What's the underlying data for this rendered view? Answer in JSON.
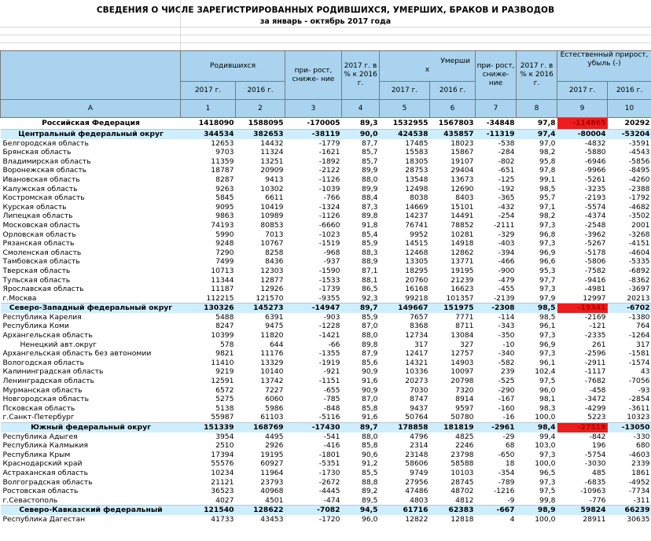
{
  "title": "СВЕДЕНИЯ О ЧИСЛЕ ЗАРЕГИСТРИРОВАННЫХ  РОДИВШИХСЯ, УМЕРШИХ, БРАКОВ И РАЗВОДОВ",
  "subtitle": "за январь - октябрь 2017 года",
  "header": {
    "births": "Родившихся",
    "births_growth": "при- рост, сниже- ние",
    "births_pct": "2017 г. в % к 2016 г.",
    "deaths_a": "Умерши",
    "deaths_b": "х",
    "deaths_growth": "при- рост, сниже- ние",
    "deaths_pct": "2017 г. в % к 2016 г.",
    "natural": "Естественный прирост, убыль (-)",
    "y2017": "2017 г.",
    "y2016": "2016 г.",
    "col_labels": [
      "A",
      "1",
      "2",
      "3",
      "4",
      "5",
      "6",
      "7",
      "8",
      "9",
      "10"
    ]
  },
  "highlight_color": "#ee1c1c",
  "district_color": "#cfeefd",
  "rows": [
    {
      "name": "Российская Федерация",
      "v": [
        "1418090",
        "1588095",
        "-170005",
        "89,3",
        "1532955",
        "1567803",
        "-34848",
        "97,8",
        "-114865",
        "20292"
      ],
      "type": "rf",
      "red": true
    },
    {
      "name": "Центральный федеральный округ",
      "v": [
        "344534",
        "382653",
        "-38119",
        "90,0",
        "424538",
        "435857",
        "-11319",
        "97,4",
        "-80004",
        "-53204"
      ],
      "type": "fd"
    },
    {
      "name": "Белгородская область",
      "v": [
        "12653",
        "14432",
        "-1779",
        "87,7",
        "17485",
        "18023",
        "-538",
        "97,0",
        "-4832",
        "-3591"
      ]
    },
    {
      "name": "Брянская область",
      "v": [
        "9703",
        "11324",
        "-1621",
        "85,7",
        "15583",
        "15867",
        "-284",
        "98,2",
        "-5880",
        "-4543"
      ]
    },
    {
      "name": "Владимирская область",
      "v": [
        "11359",
        "13251",
        "-1892",
        "85,7",
        "18305",
        "19107",
        "-802",
        "95,8",
        "-6946",
        "-5856"
      ]
    },
    {
      "name": "Воронежская область",
      "v": [
        "18787",
        "20909",
        "-2122",
        "89,9",
        "28753",
        "29404",
        "-651",
        "97,8",
        "-9966",
        "-8495"
      ]
    },
    {
      "name": "Ивановская область",
      "v": [
        "8287",
        "9413",
        "-1126",
        "88,0",
        "13548",
        "13673",
        "-125",
        "99,1",
        "-5261",
        "-4260"
      ]
    },
    {
      "name": "Калужская область",
      "v": [
        "9263",
        "10302",
        "-1039",
        "89,9",
        "12498",
        "12690",
        "-192",
        "98,5",
        "-3235",
        "-2388"
      ]
    },
    {
      "name": "Костромская область",
      "v": [
        "5845",
        "6611",
        "-766",
        "88,4",
        "8038",
        "8403",
        "-365",
        "95,7",
        "-2193",
        "-1792"
      ]
    },
    {
      "name": "Курская область",
      "v": [
        "9095",
        "10419",
        "-1324",
        "87,3",
        "14669",
        "15101",
        "-432",
        "97,1",
        "-5574",
        "-4682"
      ]
    },
    {
      "name": "Липецкая область",
      "v": [
        "9863",
        "10989",
        "-1126",
        "89,8",
        "14237",
        "14491",
        "-254",
        "98,2",
        "-4374",
        "-3502"
      ]
    },
    {
      "name": "Московская область",
      "v": [
        "74193",
        "80853",
        "-6660",
        "91,8",
        "76741",
        "78852",
        "-2111",
        "97,3",
        "-2548",
        "2001"
      ]
    },
    {
      "name": "Орловская область",
      "v": [
        "5990",
        "7013",
        "-1023",
        "85,4",
        "9952",
        "10281",
        "-329",
        "96,8",
        "-3962",
        "-3268"
      ]
    },
    {
      "name": "Рязанская область",
      "v": [
        "9248",
        "10767",
        "-1519",
        "85,9",
        "14515",
        "14918",
        "-403",
        "97,3",
        "-5267",
        "-4151"
      ]
    },
    {
      "name": "Смоленская область",
      "v": [
        "7290",
        "8258",
        "-968",
        "88,3",
        "12468",
        "12862",
        "-394",
        "96,9",
        "-5178",
        "-4604"
      ]
    },
    {
      "name": "Тамбовская область",
      "v": [
        "7499",
        "8436",
        "-937",
        "88,9",
        "13305",
        "13771",
        "-466",
        "96,6",
        "-5806",
        "-5335"
      ]
    },
    {
      "name": "Тверская область",
      "v": [
        "10713",
        "12303",
        "-1590",
        "87,1",
        "18295",
        "19195",
        "-900",
        "95,3",
        "-7582",
        "-6892"
      ]
    },
    {
      "name": "Тульская область",
      "v": [
        "11344",
        "12877",
        "-1533",
        "88,1",
        "20760",
        "21239",
        "-479",
        "97,7",
        "-9416",
        "-8362"
      ]
    },
    {
      "name": "Ярославская область",
      "v": [
        "11187",
        "12926",
        "-1739",
        "86,5",
        "16168",
        "16623",
        "-455",
        "97,3",
        "-4981",
        "-3697"
      ]
    },
    {
      "name": "г.Москва",
      "v": [
        "112215",
        "121570",
        "-9355",
        "92,3",
        "99218",
        "101357",
        "-2139",
        "97,9",
        "12997",
        "20213"
      ]
    },
    {
      "name": "Северо-Западный федеральный округ",
      "v": [
        "130326",
        "145273",
        "-14947",
        "89,7",
        "149667",
        "151975",
        "-2308",
        "98,5",
        "-19341",
        "-6702"
      ],
      "type": "fd",
      "red": true
    },
    {
      "name": "Республика Карелия",
      "v": [
        "5488",
        "6391",
        "-903",
        "85,9",
        "7657",
        "7771",
        "-114",
        "98,5",
        "-2169",
        "-1380"
      ]
    },
    {
      "name": "Республика Коми",
      "v": [
        "8247",
        "9475",
        "-1228",
        "87,0",
        "8368",
        "8711",
        "-343",
        "96,1",
        "-121",
        "764"
      ]
    },
    {
      "name": "Архангельская область",
      "v": [
        "10399",
        "11820",
        "-1421",
        "88,0",
        "12734",
        "13084",
        "-350",
        "97,3",
        "-2335",
        "-1264"
      ]
    },
    {
      "name": "Ненецкий авт.округ",
      "v": [
        "578",
        "644",
        "-66",
        "89,8",
        "317",
        "327",
        "-10",
        "96,9",
        "261",
        "317"
      ],
      "type": "indent"
    },
    {
      "name": "Архангельская область без автономии",
      "v": [
        "9821",
        "11176",
        "-1355",
        "87,9",
        "12417",
        "12757",
        "-340",
        "97,3",
        "-2596",
        "-1581"
      ]
    },
    {
      "name": "Вологодская область",
      "v": [
        "11410",
        "13329",
        "-1919",
        "85,6",
        "14321",
        "14903",
        "-582",
        "96,1",
        "-2911",
        "-1574"
      ]
    },
    {
      "name": "Калининградская область",
      "v": [
        "9219",
        "10140",
        "-921",
        "90,9",
        "10336",
        "10097",
        "239",
        "102,4",
        "-1117",
        "43"
      ]
    },
    {
      "name": "Ленинградская область",
      "v": [
        "12591",
        "13742",
        "-1151",
        "91,6",
        "20273",
        "20798",
        "-525",
        "97,5",
        "-7682",
        "-7056"
      ]
    },
    {
      "name": "Мурманская область",
      "v": [
        "6572",
        "7227",
        "-655",
        "90,9",
        "7030",
        "7320",
        "-290",
        "96,0",
        "-458",
        "-93"
      ]
    },
    {
      "name": "Новгородская область",
      "v": [
        "5275",
        "6060",
        "-785",
        "87,0",
        "8747",
        "8914",
        "-167",
        "98,1",
        "-3472",
        "-2854"
      ]
    },
    {
      "name": "Псковская область",
      "v": [
        "5138",
        "5986",
        "-848",
        "85,8",
        "9437",
        "9597",
        "-160",
        "98,3",
        "-4299",
        "-3611"
      ]
    },
    {
      "name": "г.Санкт-Петербург",
      "v": [
        "55987",
        "61103",
        "-5116",
        "91,6",
        "50764",
        "50780",
        "-16",
        "100,0",
        "5223",
        "10323"
      ]
    },
    {
      "name": "Южный федеральный округ",
      "v": [
        "151339",
        "168769",
        "-17430",
        "89,7",
        "178858",
        "181819",
        "-2961",
        "98,4",
        "-27519",
        "-13050"
      ],
      "type": "fd",
      "red": true
    },
    {
      "name": "Республика Адыгея",
      "v": [
        "3954",
        "4495",
        "-541",
        "88,0",
        "4796",
        "4825",
        "-29",
        "99,4",
        "-842",
        "-330"
      ]
    },
    {
      "name": "Республика Калмыкия",
      "v": [
        "2510",
        "2926",
        "-416",
        "85,8",
        "2314",
        "2246",
        "68",
        "103,0",
        "196",
        "680"
      ]
    },
    {
      "name": "Республика Крым",
      "v": [
        "17394",
        "19195",
        "-1801",
        "90,6",
        "23148",
        "23798",
        "-650",
        "97,3",
        "-5754",
        "-4603"
      ]
    },
    {
      "name": "Краснодарский край",
      "v": [
        "55576",
        "60927",
        "-5351",
        "91,2",
        "58606",
        "58588",
        "18",
        "100,0",
        "-3030",
        "2339"
      ]
    },
    {
      "name": "Астраханская область",
      "v": [
        "10234",
        "11964",
        "-1730",
        "85,5",
        "9749",
        "10103",
        "-354",
        "96,5",
        "485",
        "1861"
      ]
    },
    {
      "name": "Волгоградская область",
      "v": [
        "21121",
        "23793",
        "-2672",
        "88,8",
        "27956",
        "28745",
        "-789",
        "97,3",
        "-6835",
        "-4952"
      ]
    },
    {
      "name": "Ростовская область",
      "v": [
        "36523",
        "40968",
        "-4445",
        "89,2",
        "47486",
        "48702",
        "-1216",
        "97,5",
        "-10963",
        "-7734"
      ]
    },
    {
      "name": "г.Севастополь",
      "v": [
        "4027",
        "4501",
        "-474",
        "89,5",
        "4803",
        "4812",
        "-9",
        "99,8",
        "-776",
        "-311"
      ]
    },
    {
      "name": "Северо-Кавказский федеральный",
      "v": [
        "121540",
        "128622",
        "-7082",
        "94,5",
        "61716",
        "62383",
        "-667",
        "98,9",
        "59824",
        "66239"
      ],
      "type": "fd"
    },
    {
      "name": "Республика Дагестан",
      "v": [
        "41733",
        "43453",
        "-1720",
        "96,0",
        "12822",
        "12818",
        "4",
        "100,0",
        "28911",
        "30635"
      ]
    }
  ]
}
